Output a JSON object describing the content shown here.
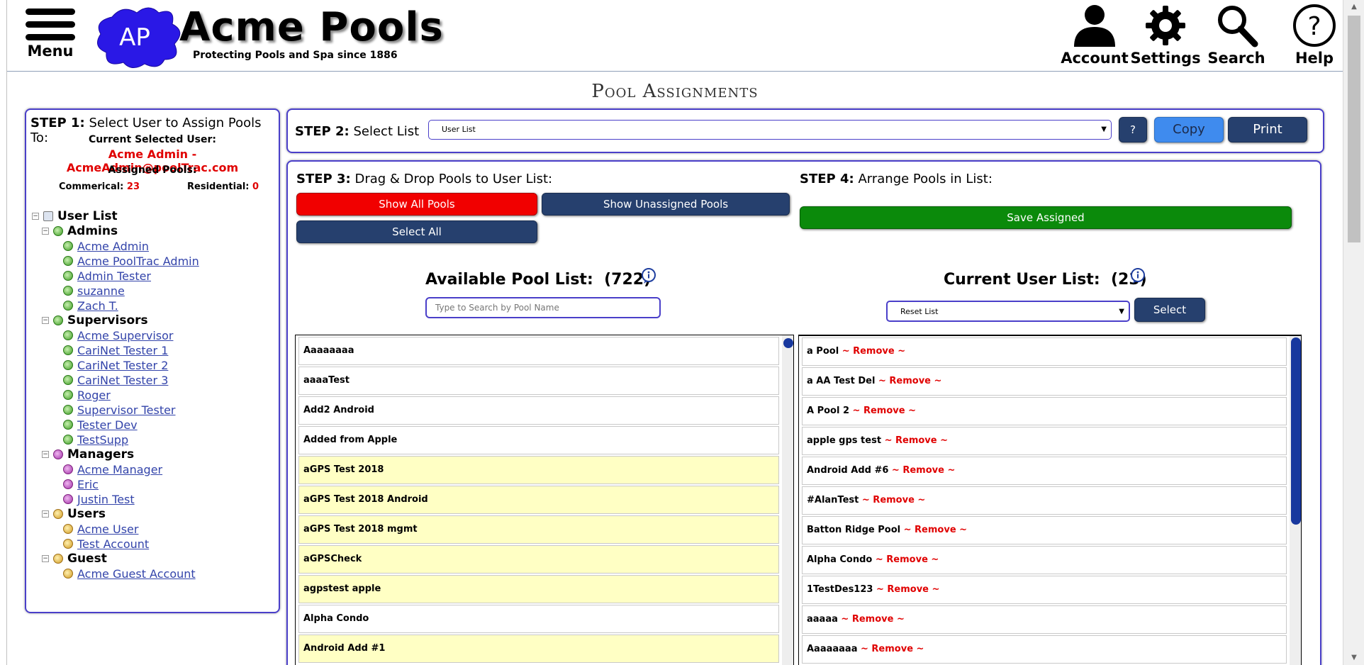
{
  "header": {
    "menu_label": "Menu",
    "logo_text": "AP",
    "brand_title": "Acme Pools",
    "brand_subtitle": "Protecting Pools and Spa since 1886",
    "nav": [
      {
        "label": "Account",
        "icon": "account-icon"
      },
      {
        "label": "Settings",
        "icon": "gear-icon"
      },
      {
        "label": "Search",
        "icon": "search-icon"
      },
      {
        "label": "Help",
        "icon": "help-icon"
      }
    ]
  },
  "page_title": "Pool Assignments",
  "step1": {
    "label": "STEP 1:",
    "text": "Select User to Assign Pools To:",
    "current_user_label": "Current Selected User:",
    "current_user": "Acme Admin - AcmeAdmin@poolTrac.com",
    "assigned_label": "Assigned Pools:",
    "commercial_label": "Commerical:",
    "commercial_count": "23",
    "residential_label": "Residential:",
    "residential_count": "0",
    "tree_root": "User List",
    "groups": [
      {
        "name": "Admins",
        "color": "green",
        "users": [
          "Acme Admin",
          "Acme PoolTrac Admin",
          "Admin Tester",
          "suzanne",
          "Zach T."
        ]
      },
      {
        "name": "Supervisors",
        "color": "green",
        "users": [
          "Acme Supervisor",
          "CariNet Tester 1",
          "CariNet Tester 2",
          "CariNet Tester 3",
          "Roger",
          "Supervisor Tester",
          "Tester Dev",
          "TestSupp"
        ]
      },
      {
        "name": "Managers",
        "color": "purple",
        "users": [
          "Acme Manager",
          "Eric",
          "Justin Test"
        ]
      },
      {
        "name": "Users",
        "color": "gold",
        "users": [
          "Acme User",
          "Test Account"
        ]
      },
      {
        "name": "Guest",
        "color": "gold",
        "users": [
          "Acme Guest Account"
        ]
      }
    ]
  },
  "step2": {
    "label": "STEP 2:",
    "text": "Select List",
    "select_value": "User List",
    "help_btn": "?",
    "copy_btn": "Copy",
    "print_btn": "Print"
  },
  "step3": {
    "label": "STEP 3:",
    "text": "Drag & Drop Pools to User List:",
    "show_all": "Show All Pools",
    "show_unassigned": "Show Unassigned Pools",
    "select_all": "Select All",
    "available_title": "Available Pool List:",
    "available_count": "(722)",
    "search_placeholder": "Type to Search by Pool Name",
    "pools": [
      {
        "name": "Aaaaaaaa",
        "highlight": false
      },
      {
        "name": "aaaaTest",
        "highlight": false
      },
      {
        "name": "Add2 Android",
        "highlight": false
      },
      {
        "name": "Added from Apple",
        "highlight": false
      },
      {
        "name": "aGPS Test 2018",
        "highlight": true
      },
      {
        "name": "aGPS Test 2018 Android",
        "highlight": true
      },
      {
        "name": "aGPS Test 2018 mgmt",
        "highlight": true
      },
      {
        "name": "aGPSCheck",
        "highlight": true
      },
      {
        "name": "agpstest apple",
        "highlight": true
      },
      {
        "name": "Alpha Condo",
        "highlight": false
      },
      {
        "name": "Android Add #1",
        "highlight": true
      }
    ]
  },
  "step4": {
    "label": "STEP 4:",
    "text": "Arrange Pools in List:",
    "save_btn": "Save Assigned",
    "current_title": "Current User List:",
    "current_count": "(23)",
    "reset_select": "Reset List",
    "select_btn": "Select",
    "remove_text": "~ Remove ~",
    "assigned": [
      "a Pool",
      "a AA Test Del",
      "A Pool 2",
      "apple gps test",
      "Android Add #6",
      "#AlanTest",
      "Batton Ridge Pool",
      "Alpha Condo",
      "1TestDes123",
      "aaaaa",
      "Aaaaaaaa"
    ]
  },
  "colors": {
    "accent": "#4a3fc9",
    "navy": "#26406e",
    "red": "#f10000",
    "green": "#0b8a0b",
    "highlight": "#ffffc4"
  }
}
